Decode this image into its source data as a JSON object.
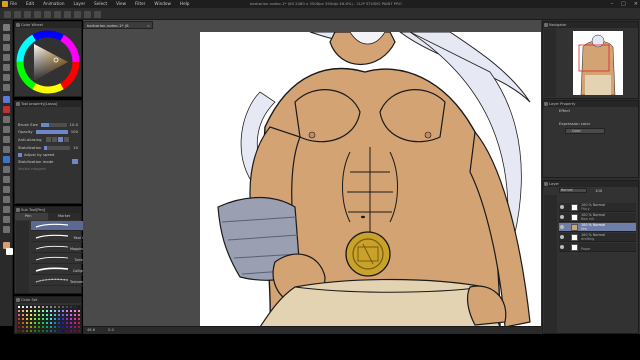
{
  "app": {
    "window_title": "barbarian-rodeo-1* (64 2480 x 3508px 350dpi 46.6%) - CLIP STUDIO PAINT PRO",
    "menu": [
      "File",
      "Edit",
      "Animation",
      "Layer",
      "Select",
      "View",
      "Filter",
      "Window",
      "Help"
    ]
  },
  "color_wheel": {
    "title": "Color Wheel"
  },
  "tool_property": {
    "title": "Tool property[Lasso]",
    "brush_size_label": "Brush Size",
    "brush_size_value": "10.0",
    "opacity_label": "Opacity",
    "opacity_value": "100",
    "opacity_fraction": 1.0,
    "brush_size_fraction": 0.3,
    "antialias_label": "Anti-aliasing",
    "stabilization_label": "Stabilization",
    "stabilization_value": "10",
    "adjust_speed_label": "Adjust by speed",
    "stab_mode_label": "Stabilization mode",
    "vector_magnet_label": "Vector magnet"
  },
  "sub_tool": {
    "tab1": "Sub Tool[Pen]",
    "group_label": "Pen",
    "group_label2": "Marker",
    "brushes": [
      "Loom",
      "Real G-Pen",
      "Mapping pen",
      "Turnip pen",
      "Calligraphy",
      "Textured pen"
    ]
  },
  "color_set": {
    "title": "Color Set"
  },
  "navigator": {
    "title": "Navigator"
  },
  "layer_property": {
    "title": "Layer Property",
    "effect_label": "Effect",
    "expression_label": "Expression color",
    "expression_value": "Color"
  },
  "layers": {
    "title": "Layer",
    "blend_mode": "Normal",
    "opacity": "100",
    "items": [
      {
        "name": "100 % Normal",
        "sub": "Ffury"
      },
      {
        "name": "100 % Normal",
        "sub": "flow ink"
      },
      {
        "name": "100 % Normal",
        "sub": "Hm"
      },
      {
        "name": "100 % Normal",
        "sub": "drafting"
      },
      {
        "name": "",
        "sub": "Paper"
      }
    ],
    "selected_index": 2
  },
  "canvas": {
    "tab": "barbarian-rodeo-1* (6"
  },
  "status": {
    "zoom": "46.6",
    "angle": "0.0"
  },
  "colors": {
    "accent": "#6d87c9",
    "panel": "#323232",
    "skin": "#d4a374",
    "gold": "#c9a22a",
    "pants": "#e3d3b3",
    "wrap": "#9a9fb2"
  }
}
